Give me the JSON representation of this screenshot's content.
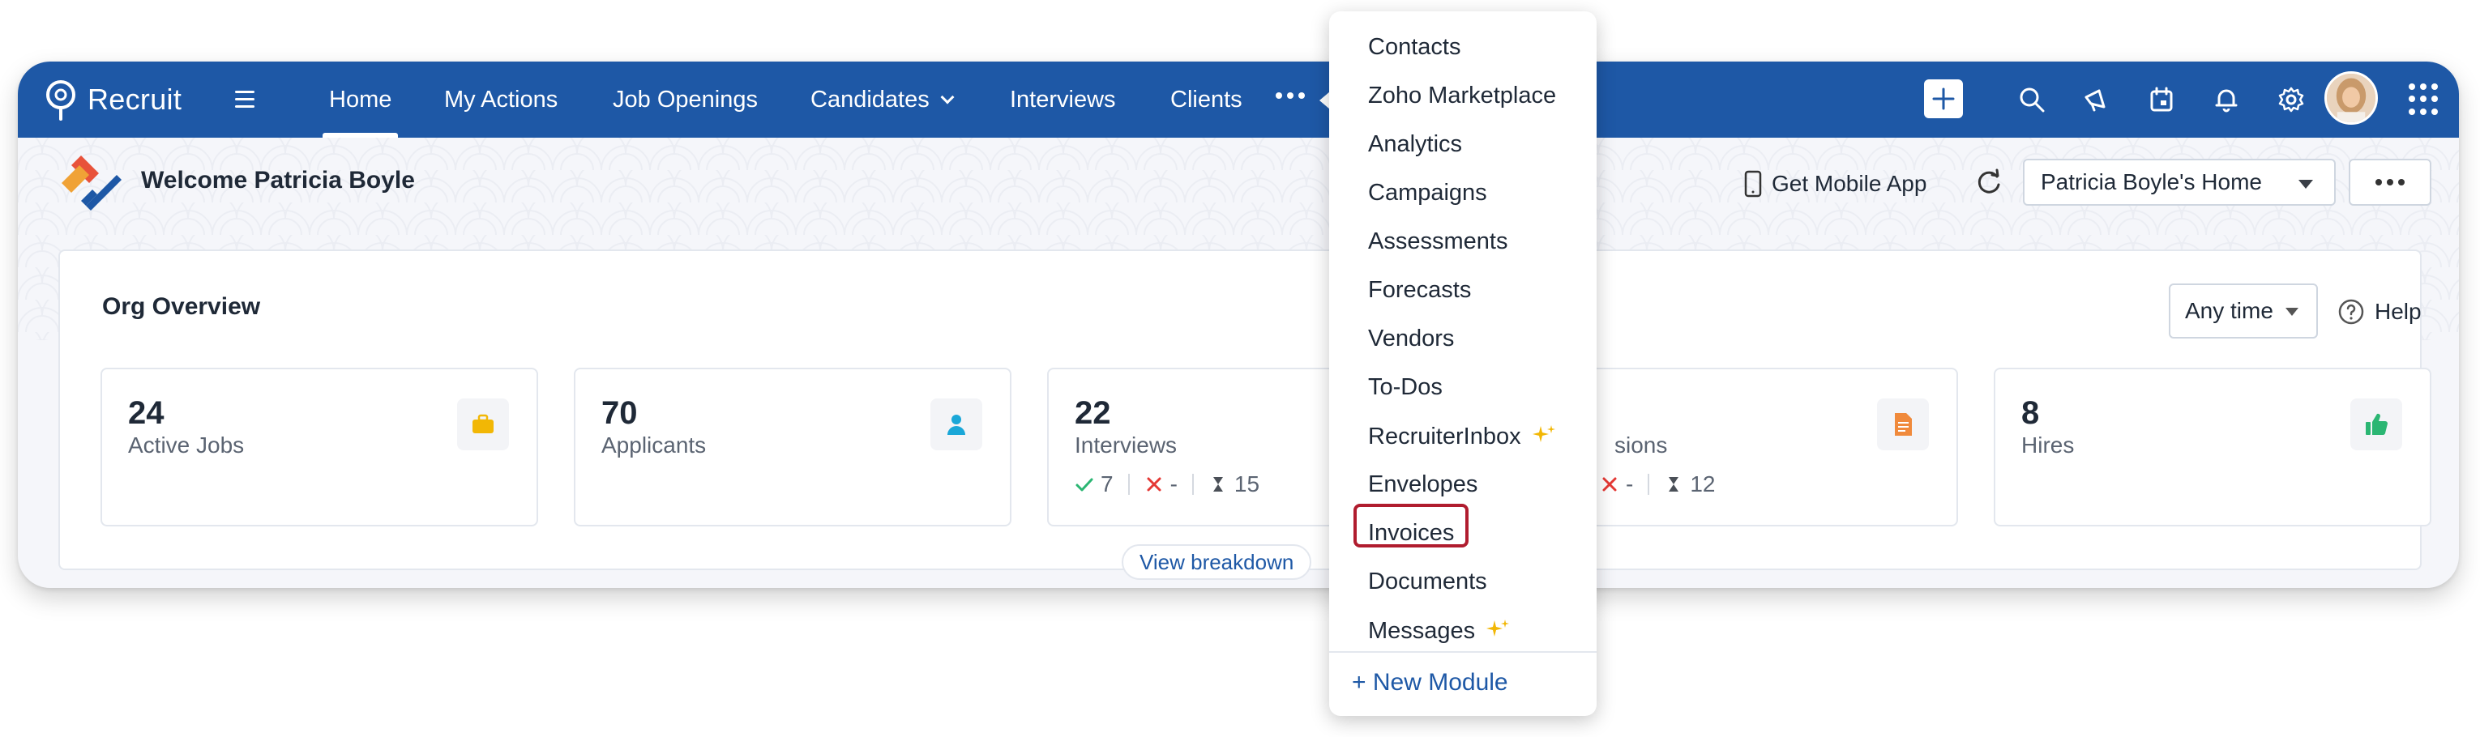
{
  "app": {
    "name": "Recruit"
  },
  "nav": {
    "items": [
      {
        "label": "Home",
        "active": true
      },
      {
        "label": "My Actions"
      },
      {
        "label": "Job Openings"
      },
      {
        "label": "Candidates",
        "has_dropdown": true
      },
      {
        "label": "Interviews"
      },
      {
        "label": "Clients"
      }
    ],
    "right_icons": [
      "plus-icon",
      "search-icon",
      "announcement-icon",
      "calendar-icon",
      "bell-icon",
      "gear-icon",
      "avatar",
      "apps-grid-icon"
    ]
  },
  "welcome": {
    "text": "Welcome Patricia Boyle",
    "mobile_app_label": "Get Mobile App",
    "home_select_value": "Patricia Boyle's Home"
  },
  "org_overview": {
    "title": "Org Overview",
    "time_filter": "Any time",
    "help_label": "Help",
    "cards": [
      {
        "value": "24",
        "label": "Active Jobs",
        "icon": "briefcase-icon",
        "icon_color": "#f2b705"
      },
      {
        "value": "70",
        "label": "Applicants",
        "icon": "person-icon",
        "icon_color": "#1aa7d8"
      },
      {
        "value": "22",
        "label": "Interviews",
        "icon": "calendar-icon",
        "sub": {
          "passed": "7",
          "failed": "-",
          "pending": "15"
        }
      },
      {
        "value": "",
        "label": "sions",
        "icon": "document-icon",
        "icon_color": "#f08a3c",
        "sub": {
          "failed": "-",
          "pending": "12"
        }
      },
      {
        "value": "8",
        "label": "Hires",
        "icon": "thumbs-up-icon",
        "icon_color": "#2bb673"
      }
    ],
    "view_breakdown_label": "View breakdown"
  },
  "more_menu": {
    "items": [
      {
        "label": "Contacts"
      },
      {
        "label": "Zoho Marketplace"
      },
      {
        "label": "Analytics"
      },
      {
        "label": "Campaigns"
      },
      {
        "label": "Assessments"
      },
      {
        "label": "Forecasts"
      },
      {
        "label": "Vendors"
      },
      {
        "label": "To-Dos"
      },
      {
        "label": "RecruiterInbox",
        "sparkle": true
      },
      {
        "label": "Envelopes"
      },
      {
        "label": "Invoices",
        "highlighted": true
      },
      {
        "label": "Documents"
      },
      {
        "label": "Messages",
        "sparkle": true
      }
    ],
    "new_module_label": "+ New Module"
  },
  "colors": {
    "nav_bg": "#1e58a6",
    "accent": "#1e58a6",
    "highlight_border": "#b01c2e",
    "sparkle": "#f2b705"
  }
}
